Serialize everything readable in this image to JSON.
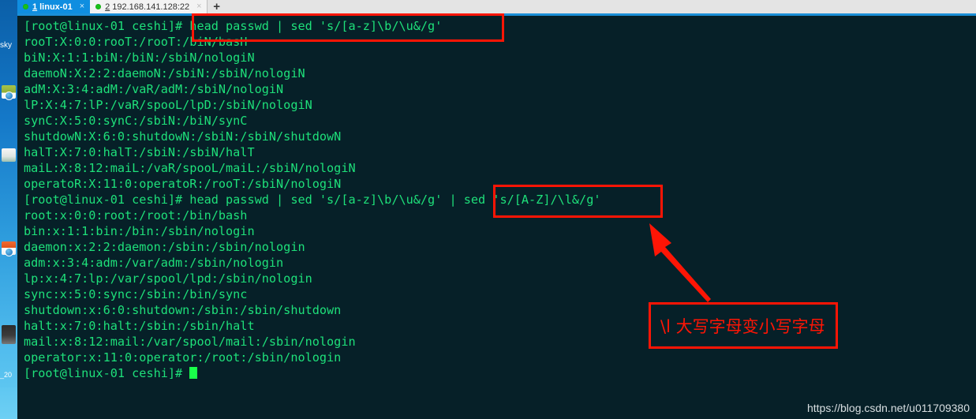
{
  "desktop": {
    "label": "sky",
    "icons": [
      {
        "name": "notepad-shortcut-icon"
      },
      {
        "name": "folder-shortcut-icon"
      },
      {
        "name": "installer-shortcut-icon"
      },
      {
        "name": "video-thumbnail-icon"
      }
    ],
    "bottom_text": "_20"
  },
  "tabs": [
    {
      "num": "1",
      "label": "linux-01",
      "active": true,
      "status": "connected",
      "close": "×"
    },
    {
      "num": "2",
      "label": "192.168.141.128:22",
      "active": false,
      "status": "connected",
      "close": "×"
    }
  ],
  "new_tab_button": "+",
  "terminal": {
    "lines": [
      "[root@linux-01 ceshi]# head passwd | sed 's/[a-z]\\b/\\u&/g'",
      "rooT:X:0:0:rooT:/rooT:/biN/basH",
      "biN:X:1:1:biN:/biN:/sbiN/nologiN",
      "daemoN:X:2:2:daemoN:/sbiN:/sbiN/nologiN",
      "adM:X:3:4:adM:/vaR/adM:/sbiN/nologiN",
      "lP:X:4:7:lP:/vaR/spooL/lpD:/sbiN/nologiN",
      "synC:X:5:0:synC:/sbiN:/biN/synC",
      "shutdowN:X:6:0:shutdowN:/sbiN:/sbiN/shutdowN",
      "halT:X:7:0:halT:/sbiN:/sbiN/halT",
      "maiL:X:8:12:maiL:/vaR/spooL/maiL:/sbiN/nologiN",
      "operatoR:X:11:0:operatoR:/rooT:/sbiN/nologiN",
      "[root@linux-01 ceshi]# head passwd | sed 's/[a-z]\\b/\\u&/g' | sed 's/[A-Z]/\\l&/g'",
      "root:x:0:0:root:/root:/bin/bash",
      "bin:x:1:1:bin:/bin:/sbin/nologin",
      "daemon:x:2:2:daemon:/sbin:/sbin/nologin",
      "adm:x:3:4:adm:/var/adm:/sbin/nologin",
      "lp:x:4:7:lp:/var/spool/lpd:/sbin/nologin",
      "sync:x:5:0:sync:/sbin:/bin/sync",
      "shutdown:x:6:0:shutdown:/sbin:/sbin/shutdown",
      "halt:x:7:0:halt:/sbin:/sbin/halt",
      "mail:x:8:12:mail:/var/spool/mail:/sbin/nologin",
      "operator:x:11:0:operator:/root:/sbin/nologin"
    ],
    "prompt": "[root@linux-01 ceshi]# "
  },
  "annotations": {
    "box1_label": "head passwd | sed 's/[a-z]\\b/\\u&/g'",
    "box2_label": "sed 's/[A-Z]/\\l&/g'",
    "note_text": "\\l 大写字母变小写字母",
    "color": "#fe1505"
  },
  "watermark": "https://blog.csdn.net/u011709380",
  "colors": {
    "terminal_bg": "#062028",
    "terminal_fg": "#1ee07a",
    "tab_active_bg": "#0f8ee0",
    "annotation": "#fe1505",
    "cursor": "#19ff4a"
  }
}
